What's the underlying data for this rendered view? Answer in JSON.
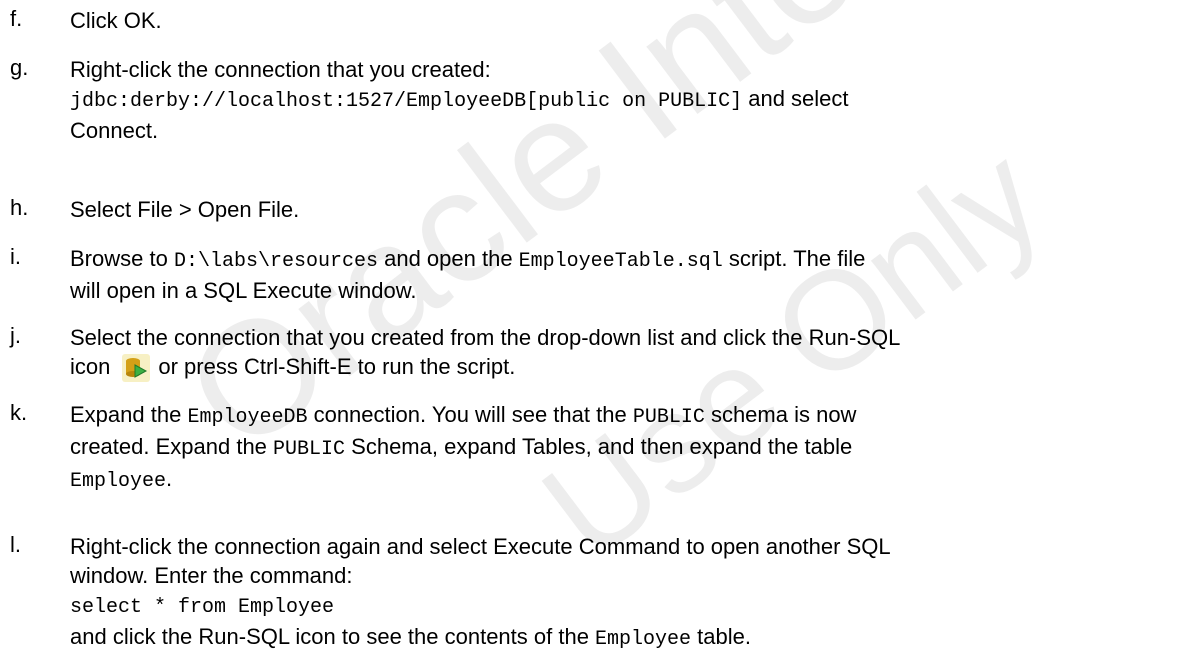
{
  "steps": [
    {
      "letter": "f.",
      "parts": [
        {
          "t": "Click OK."
        }
      ]
    },
    {
      "letter": "g.",
      "parts": [
        {
          "t": "Right-click the connection that you created:"
        },
        {
          "br": true
        },
        {
          "t": "jdbc:derby://localhost:1527/EmployeeDB[public on PUBLIC]",
          "mono": true
        },
        {
          "t": " and select"
        },
        {
          "br": true
        },
        {
          "t": "Connect."
        }
      ]
    },
    {
      "letter": "h.",
      "parts": [
        {
          "t": "Select File > Open File."
        }
      ]
    },
    {
      "letter": "i.",
      "parts": [
        {
          "t": "Browse to "
        },
        {
          "t": "D:\\labs\\resources",
          "mono": true
        },
        {
          "t": " and open the "
        },
        {
          "t": "EmployeeTable.sql",
          "mono": true
        },
        {
          "t": " script. The file"
        },
        {
          "br": true
        },
        {
          "t": "will open in a SQL Execute window."
        }
      ]
    },
    {
      "letter": "j.",
      "parts": [
        {
          "t": "Select the connection that you created from the drop-down list and click the Run-SQL"
        },
        {
          "br": true
        },
        {
          "t": "icon"
        },
        {
          "icon": "run-sql-icon"
        },
        {
          "t": "or press Ctrl-Shift-E to run the script."
        }
      ]
    },
    {
      "letter": "k.",
      "parts": [
        {
          "t": "Expand the "
        },
        {
          "t": "EmployeeDB",
          "mono": true
        },
        {
          "t": " connection. You will see that the "
        },
        {
          "t": "PUBLIC",
          "mono": true
        },
        {
          "t": " schema is now"
        },
        {
          "br": true
        },
        {
          "t": "created. Expand the "
        },
        {
          "t": "PUBLIC",
          "mono": true
        },
        {
          "t": " Schema, expand Tables, and then expand the table"
        },
        {
          "br": true
        },
        {
          "t": "Employee",
          "mono": true
        },
        {
          "t": "."
        }
      ]
    },
    {
      "letter": "l.",
      "parts": [
        {
          "t": "Right-click the connection again and select Execute Command to open another SQL"
        },
        {
          "br": true
        },
        {
          "t": "window. Enter the command:"
        },
        {
          "br": true
        },
        {
          "t": "select * from Employee",
          "mono": true
        },
        {
          "br": true
        },
        {
          "t": "and click the Run-SQL icon to see the contents of the "
        },
        {
          "t": "Employee",
          "mono": true
        },
        {
          "t": " table."
        }
      ]
    }
  ],
  "watermark": [
    "Oracle Internal & Oracle Academy",
    "Use Only"
  ],
  "colors": {
    "text": "#000000",
    "background": "#ffffff",
    "icon_bg": "#f7f0c4",
    "icon_arrow": "#3cb043",
    "icon_db": "#d4a017"
  }
}
